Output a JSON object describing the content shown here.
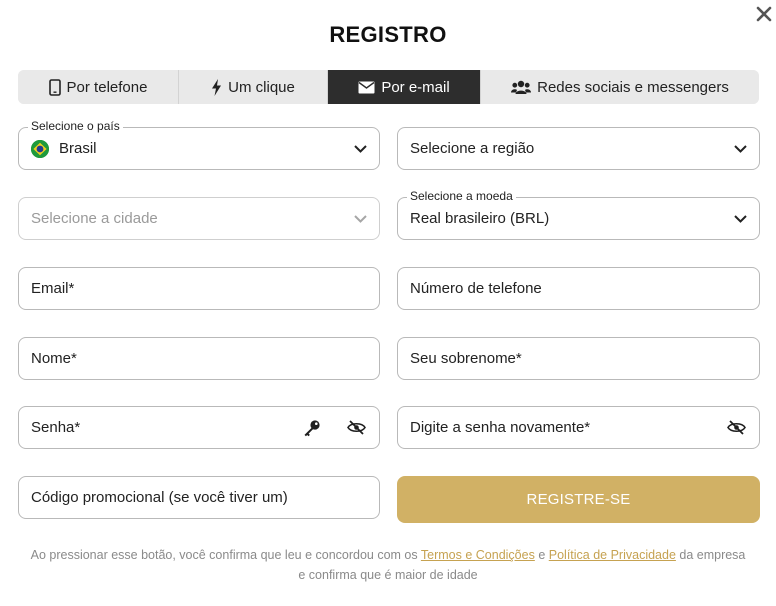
{
  "modal": {
    "title": "REGISTRO"
  },
  "tabs": [
    {
      "label": "Por telefone",
      "icon": "phone-icon"
    },
    {
      "label": "Um clique",
      "icon": "lightning-icon"
    },
    {
      "label": "Por e-mail",
      "icon": "envelope-icon",
      "active": true
    },
    {
      "label": "Redes sociais e messengers",
      "icon": "users-icon"
    }
  ],
  "form": {
    "country": {
      "label": "Selecione o país",
      "value": "Brasil",
      "icon": "brazil-flag-icon"
    },
    "region": {
      "placeholder": "Selecione a região"
    },
    "city": {
      "placeholder": "Selecione a cidade"
    },
    "currency": {
      "label": "Selecione a moeda",
      "value": "Real brasileiro (BRL)"
    },
    "email": {
      "placeholder": "Email*"
    },
    "phone": {
      "placeholder": "Número de telefone"
    },
    "first_name": {
      "placeholder": "Nome*"
    },
    "last_name": {
      "placeholder": "Seu sobrenome*"
    },
    "password": {
      "placeholder": "Senha*"
    },
    "password_repeat": {
      "placeholder": "Digite a senha novamente*"
    },
    "promo": {
      "placeholder": "Código promocional (se você tiver um)"
    },
    "submit_label": "REGISTRE-SE"
  },
  "legal": {
    "prefix": "Ao pressionar esse botão, você confirma que leu e concordou com os ",
    "terms_link": "Termos e Condições",
    "and": " e ",
    "privacy_link": "Política de Privacidade",
    "suffix": " da empresa e confirma que é maior de idade"
  },
  "colors": {
    "accent": "#d1b165",
    "link": "#c6a251",
    "tab_active_bg": "#2d2d2d",
    "tab_bg": "#e9e9e9",
    "flag_green": "#1f9a3c"
  }
}
